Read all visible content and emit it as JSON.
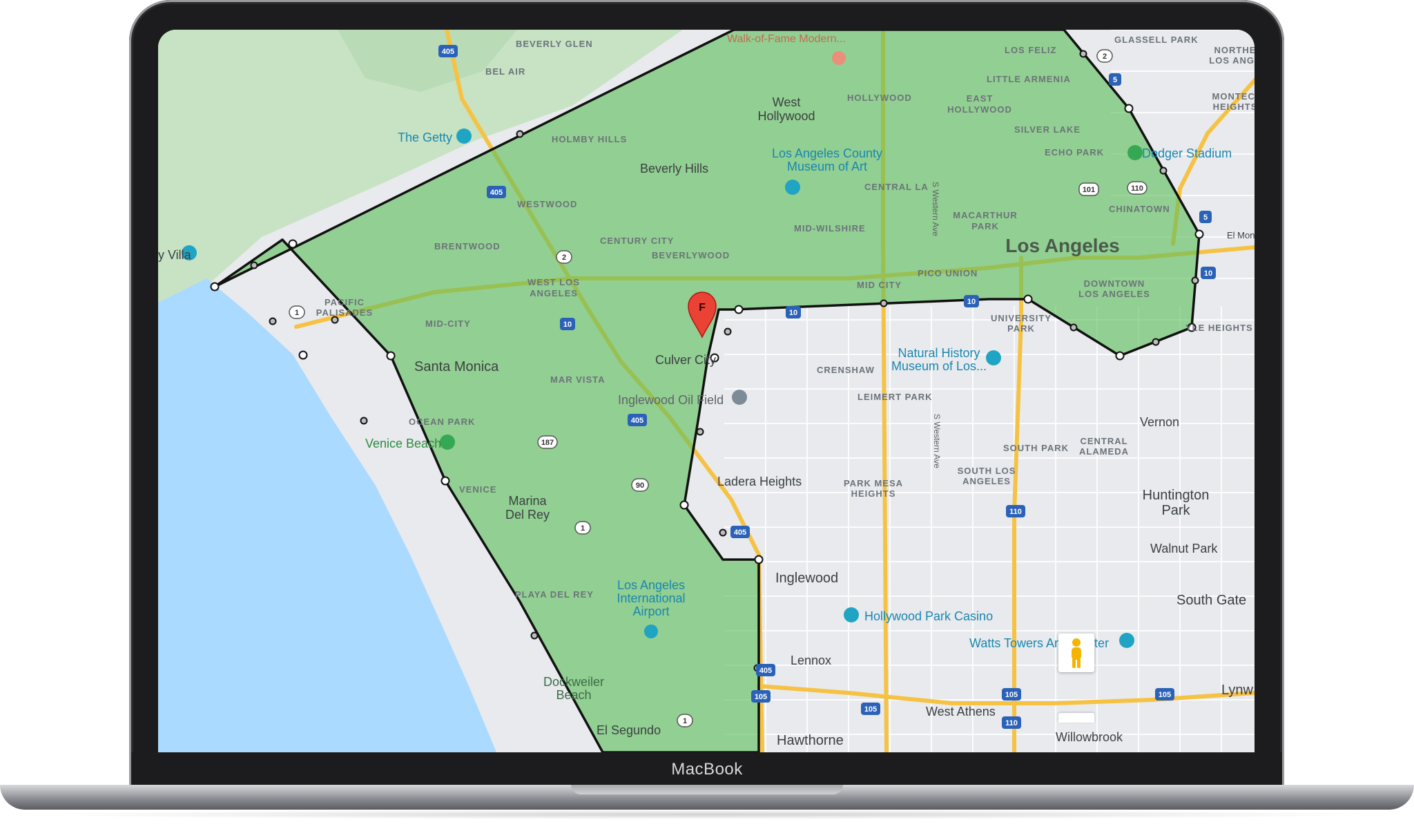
{
  "device": {
    "brand_label": "MacBook"
  },
  "map": {
    "colors": {
      "land": "#e8eaed",
      "ocean": "#aadaff",
      "hills": "#c7e3c4",
      "zone_fill": "#5ebe5a",
      "zone_stroke": "#111111",
      "freeway": "#f6c244",
      "marker": "#ea4335"
    },
    "marker": {
      "letter": "F"
    },
    "labels": {
      "beverly_glen": "BEVERLY GLEN",
      "bel_air": "BEL AIR",
      "walk_of_fame": "Walk-of-Fame Modern...",
      "los_feliz": "LOS FELIZ",
      "glassell_park": "GLASSELL PARK",
      "northeast_la": "NORTHE\nLOS ANGE",
      "little_armenia": "LITTLE ARMENIA",
      "hollywood": "HOLLYWOOD",
      "east_hollywood": "EAST\nHOLLYWOOD",
      "west_hollywood": "West\nHollywood",
      "silver_lake": "SILVER LAKE",
      "montecito_heights": "MONTECI\nHEIGHTS",
      "the_getty": "The Getty",
      "holmby_hills": "HOLMBY HILLS",
      "beverly_hills": "Beverly Hills",
      "lacma": "Los Angeles County\nMuseum of Art",
      "echo_park": "ECHO PARK",
      "dodger_stadium": "Dodger Stadium",
      "central_la": "CENTRAL LA",
      "westwood": "WESTWOOD",
      "chinatown": "CHINATOWN",
      "mid_wilshire": "MID-WILSHIRE",
      "macarthur_park": "MACARTHUR\nPARK",
      "brentwood": "BRENTWOOD",
      "century_city": "CENTURY CITY",
      "los_angeles": "Los Angeles",
      "beverlywood": "BEVERLYWOOD",
      "villa": "y Villa",
      "el_mon": "El Mon",
      "west_la": "WEST LOS\nANGELES",
      "pico_union": "PICO UNION",
      "mid_city": "MID CITY",
      "downtown_la": "DOWNTOWN\nLOS ANGELES",
      "pacific_palisades": "PACIFIC\nPALISADES",
      "mid_city_2": "MID-CITY",
      "university_park": "UNIVERSITY\nPARK",
      "boyle_heights": "YLE HEIGHTS",
      "santa_monica": "Santa Monica",
      "natural_history": "Natural History\nMuseum of Los...",
      "crenshaw": "CRENSHAW",
      "culver_city": "Culver City",
      "mar_vista": "MAR VISTA",
      "leimert_park": "LEIMERT PARK",
      "inglewood_oil": "Inglewood Oil Field",
      "vernon": "Vernon",
      "ocean_park": "OCEAN PARK",
      "venice_beach": "Venice Beach",
      "south_park": "SOUTH PARK",
      "central_alameda": "CENTRAL\nALAMEDA",
      "venice": "VENICE",
      "south_la": "SOUTH LOS\nANGELES",
      "ladera_heights": "Ladera Heights",
      "park_mesa": "PARK MESA\nHEIGHTS",
      "huntington_park": "Huntington\nPark",
      "marina_del_rey": "Marina\nDel Rey",
      "walnut_park": "Walnut Park",
      "inglewood": "Inglewood",
      "playa_del_rey": "PLAYA DEL REY",
      "lax": "Los Angeles\nInternational\nAirport",
      "south_gate": "South Gate",
      "hollywood_park": "Hollywood Park Casino",
      "watts_towers": "Watts Towers Arts Center",
      "lennox": "Lennox",
      "dockweiler": "Dockweiler\nBeach",
      "west_athens": "West Athens",
      "lynwood": "Lynw",
      "el_segundo": "El Segundo",
      "hawthorne": "Hawthorne",
      "willowbrook": "Willowbrook",
      "s_western_ave": "S Western Ave",
      "s_western_ave_2": "S Western Ave"
    },
    "shields": {
      "i405_a": "405",
      "i405_b": "405",
      "i405_c": "405",
      "i405_d": "405",
      "i405_e": "405",
      "i10_a": "10",
      "i10_b": "10",
      "i10_c": "10",
      "i10_d": "10",
      "i110_a": "110",
      "i110_b": "110",
      "i105_a": "105",
      "i105_b": "105",
      "i105_c": "105",
      "i105_d": "105",
      "i5_a": "5",
      "i5_b": "5",
      "us101": "101",
      "sr110": "110",
      "sr2_a": "2",
      "sr2_b": "2",
      "sr1_a": "1",
      "sr1_b": "1",
      "sr1_c": "1",
      "sr187": "187",
      "sr90": "90"
    }
  }
}
